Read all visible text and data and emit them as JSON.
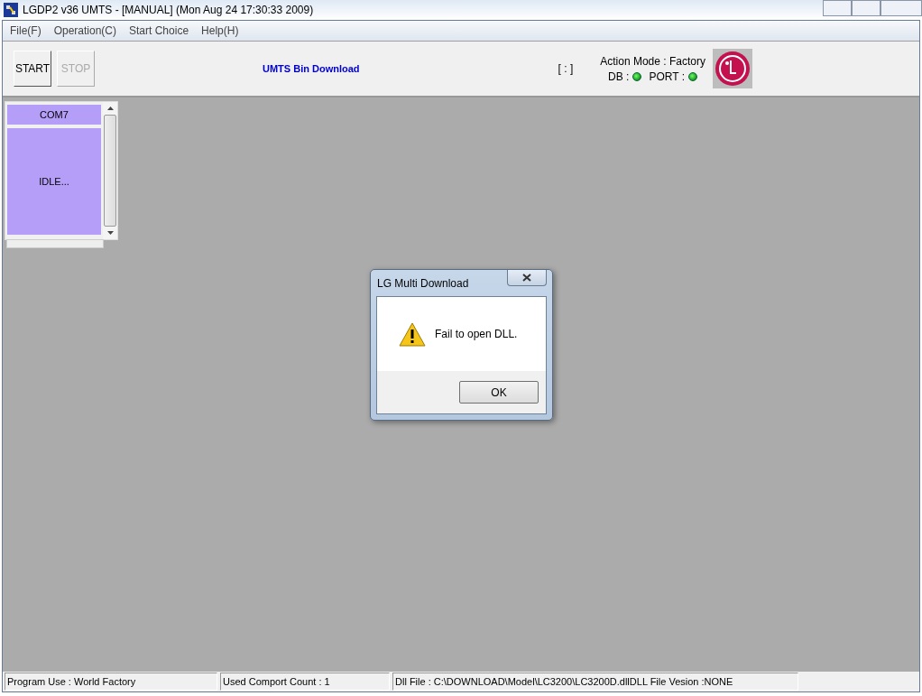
{
  "window": {
    "title": "LGDP2 v36 UMTS - [MANUAL] (Mon Aug 24 17:30:33 2009)"
  },
  "menu": [
    "File(F)",
    "Operation(C)",
    "Start Choice",
    "Help(H)"
  ],
  "toolbar": {
    "buttons": [
      {
        "label": "START",
        "disabled": false
      },
      {
        "label": "STOP",
        "disabled": true
      }
    ],
    "mode_title": "UMTS Bin Download",
    "time": "[ : ]",
    "action_mode": "Action Mode : Factory",
    "indicators": [
      {
        "label": "DB :",
        "on": true
      },
      {
        "label": "PORT :",
        "on": true
      }
    ]
  },
  "port_panel": {
    "port": "COM7",
    "status": "IDLE..."
  },
  "dialog": {
    "title": "LG Multi Download",
    "message": "Fail to open DLL.",
    "button": "OK"
  },
  "status_bar": [
    "Program Use : World Factory",
    "Used Comport Count : 1",
    "Dll File : C:\\DOWNLOAD\\Model\\LC3200\\LC3200D.dllDLL File Vesion :NONE"
  ]
}
